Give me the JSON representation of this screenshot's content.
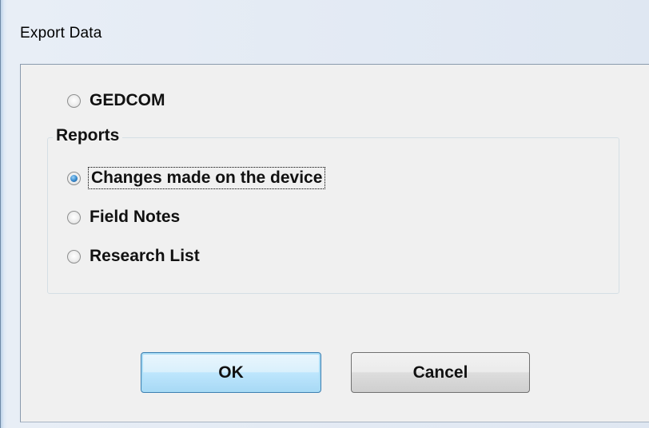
{
  "window": {
    "title": "Export Data"
  },
  "options": {
    "gedcom_label": "GEDCOM",
    "gedcom_selected": false
  },
  "reports": {
    "group_label": "Reports",
    "items": [
      {
        "label": "Changes made on the device",
        "selected": true
      },
      {
        "label": "Field Notes",
        "selected": false
      },
      {
        "label": "Research List",
        "selected": false
      }
    ]
  },
  "buttons": {
    "ok_label": "OK",
    "cancel_label": "Cancel"
  },
  "colors": {
    "dialog_background": "#f0f0f0",
    "default_button_border": "#3c7fb1",
    "radio_checked": "#3b8dd0"
  }
}
